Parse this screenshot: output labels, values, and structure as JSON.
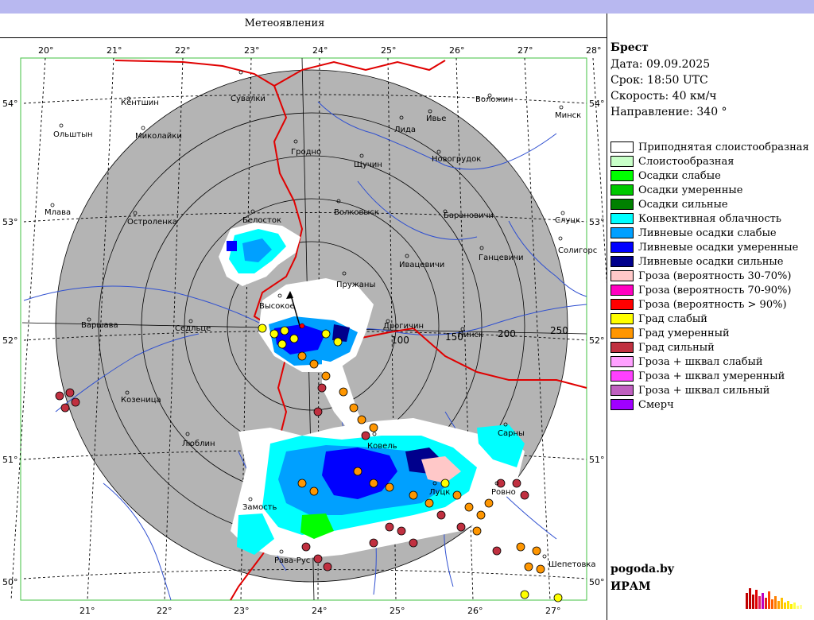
{
  "title": "Метеоявления",
  "station": {
    "name": "Брест",
    "date_label": "Дата:",
    "date": "09.09.2025",
    "time_label": "Срок:",
    "time": "18:50 UTC",
    "speed_label": "Скорость:",
    "speed": "40  км/ч",
    "direction_label": "Направление:",
    "direction": "340 °"
  },
  "legend": [
    {
      "label": "Приподнятая слоистообразная",
      "color": "#ffffff"
    },
    {
      "label": "Слоистообразная",
      "color": "#c8ffc8"
    },
    {
      "label": "Осадки слабые",
      "color": "#00ff00"
    },
    {
      "label": "Осадки умеренные",
      "color": "#00c800"
    },
    {
      "label": "Осадки сильные",
      "color": "#008000"
    },
    {
      "label": "Конвективная облачность",
      "color": "#00ffff"
    },
    {
      "label": "Ливневые осадки слабые",
      "color": "#00a0ff"
    },
    {
      "label": "Ливневые осадки умеренные",
      "color": "#0000ff"
    },
    {
      "label": "Ливневые осадки сильные",
      "color": "#00008c"
    },
    {
      "label": "Гроза (вероятность 30-70%)",
      "color": "#ffc8c8"
    },
    {
      "label": "Гроза (вероятность 70-90%)",
      "color": "#ff00c0"
    },
    {
      "label": "Гроза (вероятность > 90%)",
      "color": "#ff0000"
    },
    {
      "label": "Град слабый",
      "color": "#ffff00"
    },
    {
      "label": "Град умеренный",
      "color": "#ff9600"
    },
    {
      "label": "Град сильный",
      "color": "#c03040"
    },
    {
      "label": "Гроза + шквал слабый",
      "color": "#ffa0ff"
    },
    {
      "label": "Гроза + шквал умеренный",
      "color": "#ff40ff"
    },
    {
      "label": "Гроза + шквал сильный",
      "color": "#c060c0"
    },
    {
      "label": "Смерч",
      "color": "#a000ff"
    }
  ],
  "branding": {
    "site": "pogoda.by",
    "org": "ИРАМ"
  },
  "map": {
    "top_longitudes": [
      "20°",
      "21°",
      "22°",
      "23°",
      "24°",
      "25°",
      "26°",
      "27°",
      "28°"
    ],
    "bottom_longitudes": [
      "21°",
      "22°",
      "23°",
      "24°",
      "25°",
      "26°",
      "27°"
    ],
    "left_latitudes": [
      "54°",
      "53°",
      "52°",
      "51°",
      "50°"
    ],
    "right_latitudes": [
      "54°",
      "53°",
      "52°",
      "51°",
      "50°"
    ],
    "range_labels": [
      "100",
      "150",
      "200",
      "250"
    ],
    "cities": [
      "Кентшин",
      "Сувалки",
      "Ольштын",
      "Миколайки",
      "Гродно",
      "Лида",
      "Ивье",
      "Воложин",
      "Минск",
      "Щучин",
      "Новогрудок",
      "Млава",
      "Остроленка",
      "Белосток",
      "Волковыск",
      "Барановичи",
      "Слуцк",
      "Солигорс",
      "Ганцевичи",
      "Ивацевичи",
      "Пружаны",
      "Высокое",
      "Варшава",
      "Седльце",
      "Дрогичин",
      "Пинск",
      "Козеница",
      "Люблин",
      "Сарны",
      "Замость",
      "Рава-Рус",
      "Ковель",
      "Луцк",
      "Ровно",
      "Шепетовка"
    ]
  }
}
